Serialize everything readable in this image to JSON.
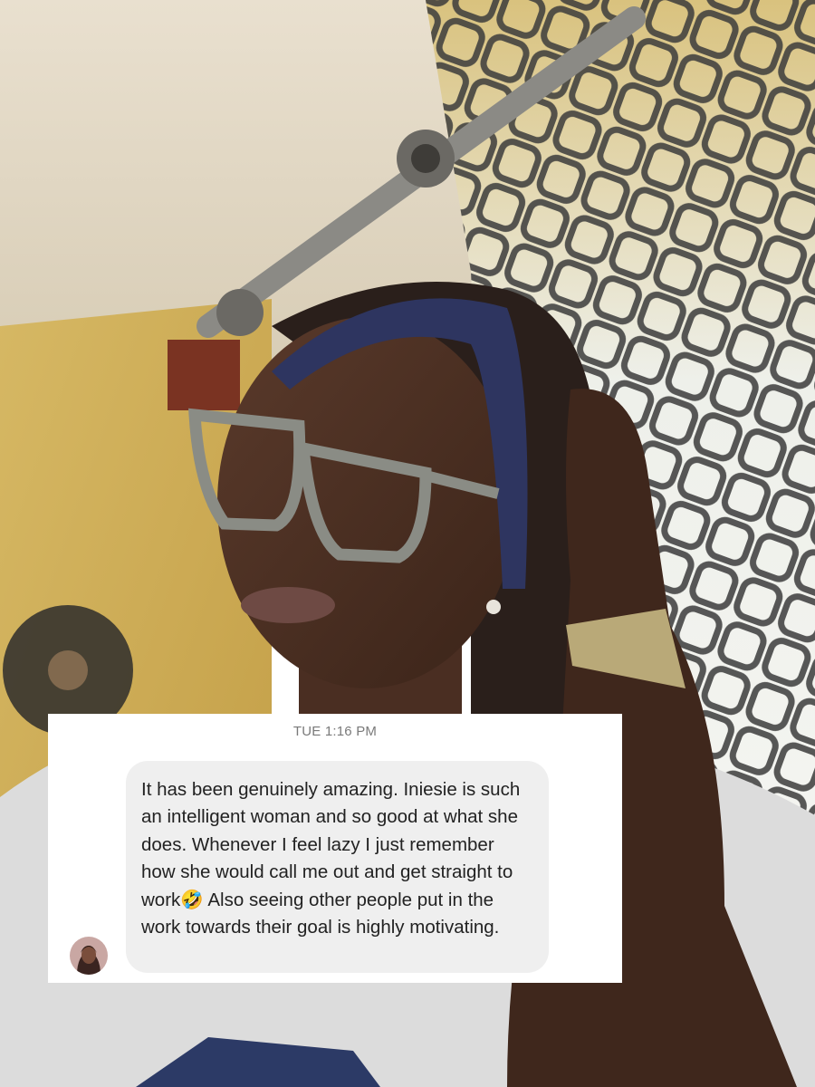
{
  "message": {
    "timestamp": "TUE 1:16 PM",
    "text": "It has been genuinely amazing. Iniesie is such an intelligent woman and so good at what she does. Whenever I feel lazy I just remember how she would call me out and get straight to work🤣 Also seeing other people put in the work towards their goal is highly motivating.",
    "sender_avatar": "profile-photo-avatar"
  },
  "colors": {
    "card_background": "#ffffff",
    "bubble_background": "#efefef",
    "message_text": "#222222",
    "timestamp_text": "#7a7a7a"
  }
}
